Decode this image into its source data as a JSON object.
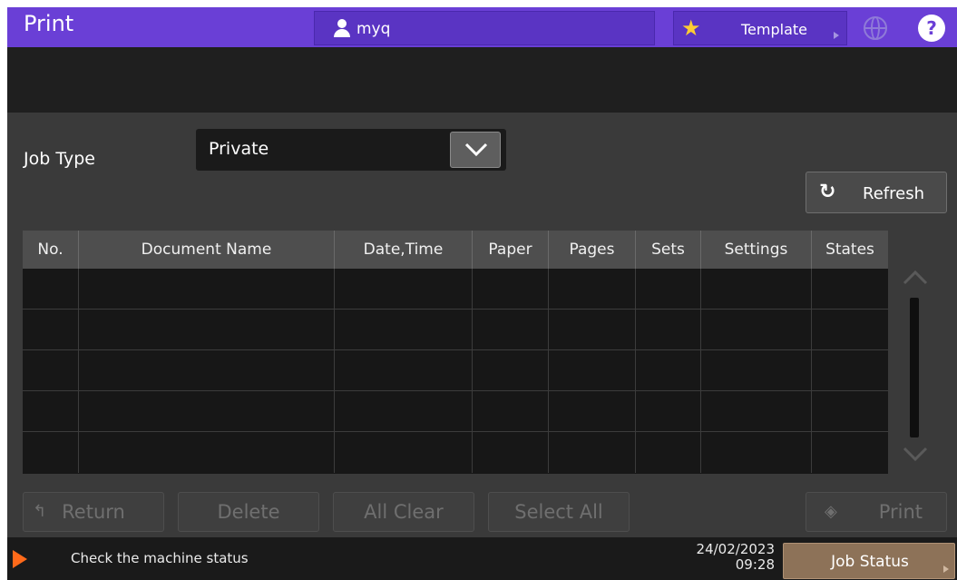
{
  "header": {
    "title": "Print",
    "user": "myq",
    "template_label": "Template"
  },
  "main": {
    "job_type_label": "Job Type",
    "job_type_value": "Private",
    "refresh_label": "Refresh",
    "table": {
      "columns": [
        "No.",
        "Document Name",
        "Date,Time",
        "Paper",
        "Pages",
        "Sets",
        "Settings",
        "States"
      ],
      "rows": []
    },
    "actions": {
      "return": "Return",
      "delete": "Delete",
      "all_clear": "All Clear",
      "select_all": "Select All",
      "print": "Print"
    }
  },
  "footer": {
    "status": "Check the machine status",
    "date": "24/02/2023",
    "time": "09:28",
    "job_status": "Job Status"
  },
  "colors": {
    "header": "#6a3fd6",
    "warning": "#ff6a1a",
    "job_status": "#8d7258"
  }
}
